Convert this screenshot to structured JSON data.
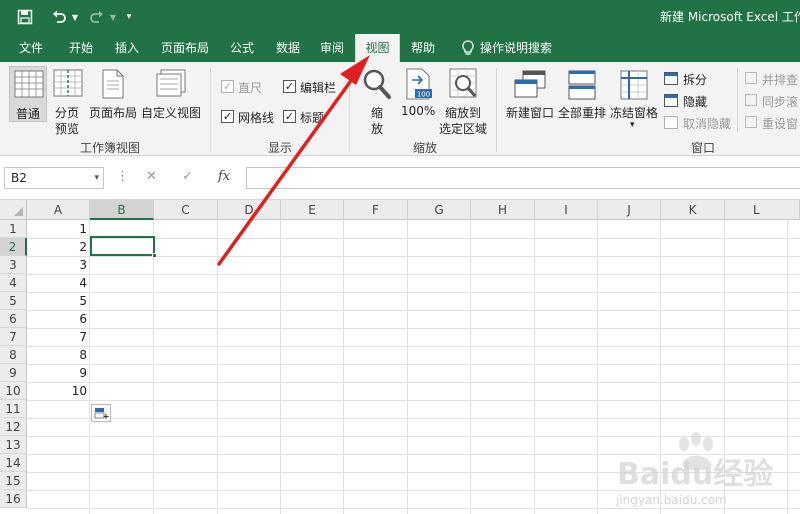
{
  "window": {
    "title": "新建 Microsoft Excel 工作"
  },
  "quick_access": {
    "save_icon": "save-icon",
    "undo_icon": "undo-icon",
    "redo_icon": "redo-icon",
    "customize_icon": "customize-icon"
  },
  "menu": {
    "tabs": [
      {
        "label": "文件"
      },
      {
        "label": "开始"
      },
      {
        "label": "插入"
      },
      {
        "label": "页面布局"
      },
      {
        "label": "公式"
      },
      {
        "label": "数据"
      },
      {
        "label": "审阅"
      },
      {
        "label": "视图",
        "active": true
      },
      {
        "label": "帮助"
      },
      {
        "label": "操作说明搜索"
      }
    ]
  },
  "ribbon": {
    "workbook_views": {
      "group_label": "工作簿视图",
      "normal": "普通",
      "page_break_1": "分页",
      "page_break_2": "预览",
      "page_layout": "页面布局",
      "custom_views": "自定义视图"
    },
    "show": {
      "group_label": "显示",
      "ruler": "直尺",
      "formula_bar": "编辑栏",
      "gridlines": "网格线",
      "headings": "标题",
      "ruler_checked": true,
      "formula_bar_checked": true,
      "gridlines_checked": true,
      "headings_checked": true
    },
    "zoom": {
      "group_label": "缩放",
      "zoom_1": "缩",
      "zoom_2": "放",
      "zoom_100": "100%",
      "zoom_sel_1": "缩放到",
      "zoom_sel_2": "选定区域"
    },
    "window": {
      "group_label": "窗口",
      "new_window": "新建窗口",
      "arrange_all": "全部重排",
      "freeze_panes": "冻结窗格",
      "split": "拆分",
      "hide": "隐藏",
      "unhide": "取消隐藏",
      "side_by_side": "并排查",
      "sync_scroll": "同步滚",
      "reset_position": "重设窗"
    }
  },
  "formula_bar": {
    "name_box": "B2",
    "cancel": "✕",
    "enter": "✓",
    "fx": "fx",
    "value": ""
  },
  "sheet": {
    "columns": [
      "A",
      "B",
      "C",
      "D",
      "E",
      "F",
      "G",
      "H",
      "I",
      "J",
      "K",
      "L"
    ],
    "rows": [
      "1",
      "2",
      "3",
      "4",
      "5",
      "6",
      "7",
      "8",
      "9",
      "10",
      "11",
      "12",
      "13",
      "14",
      "15",
      "16"
    ],
    "column_a_values": [
      "1",
      "2",
      "3",
      "4",
      "5",
      "6",
      "7",
      "8",
      "9",
      "10"
    ],
    "selected_cell": "B2"
  },
  "watermark": {
    "text": "Baidu经验",
    "url": "jingyan.baidu.com"
  },
  "colors": {
    "accent": "#217346",
    "arrow": "#e02020"
  }
}
